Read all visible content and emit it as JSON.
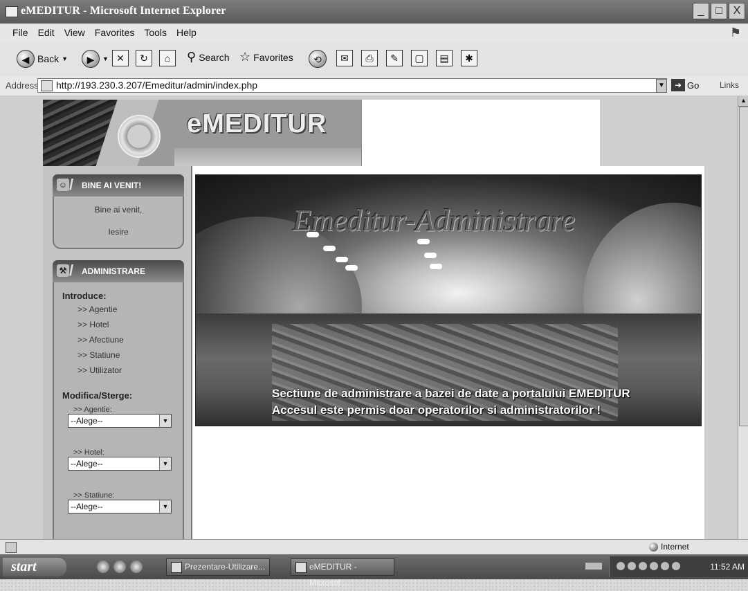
{
  "window": {
    "title": "eMEDITUR - Microsoft Internet Explorer",
    "controls": [
      "_",
      "□",
      "X"
    ]
  },
  "menu": [
    "File",
    "Edit",
    "View",
    "Favorites",
    "Tools",
    "Help"
  ],
  "toolbar": {
    "back_label": "Back",
    "search_label": "Search",
    "favorites_label": "Favorites"
  },
  "address": {
    "label": "Address",
    "url": "http://193.230.3.207/Emeditur/admin/index.php",
    "go_label": "Go",
    "links_label": "Links"
  },
  "banner": {
    "brand": "eMEDITUR"
  },
  "welcome_box": {
    "title": "BINE AI VENIT!",
    "greeting": "Bine ai venit,",
    "logout": "Iesire"
  },
  "admin_box": {
    "title": "ADMINISTRARE",
    "introduce_label": "Introduce:",
    "introduce_links": [
      ">> Agentie",
      ">> Hotel",
      ">> Afectiune",
      ">> Statiune",
      ">> Utilizator"
    ],
    "modify_label": "Modifica/Sterge:",
    "selects": [
      {
        "label": ">> Agentie:",
        "value": "--Alege--"
      },
      {
        "label": ">> Hotel:",
        "value": "--Alege--"
      },
      {
        "label": ">> Statiune:",
        "value": "--Alege--"
      }
    ]
  },
  "hero": {
    "heading": "Emeditur-Administrare",
    "caption1": "Sectiune de administrare a bazei de date a portalului EMEDITUR",
    "caption2": "Accesul este permis doar operatorilor si administratorilor !"
  },
  "statusbar": {
    "zone": "Internet"
  },
  "taskbar": {
    "start_label": "start",
    "items": [
      "Prezentare-Utilizare...",
      "eMEDITUR - Microsof..."
    ],
    "clock": "11:52 AM"
  }
}
